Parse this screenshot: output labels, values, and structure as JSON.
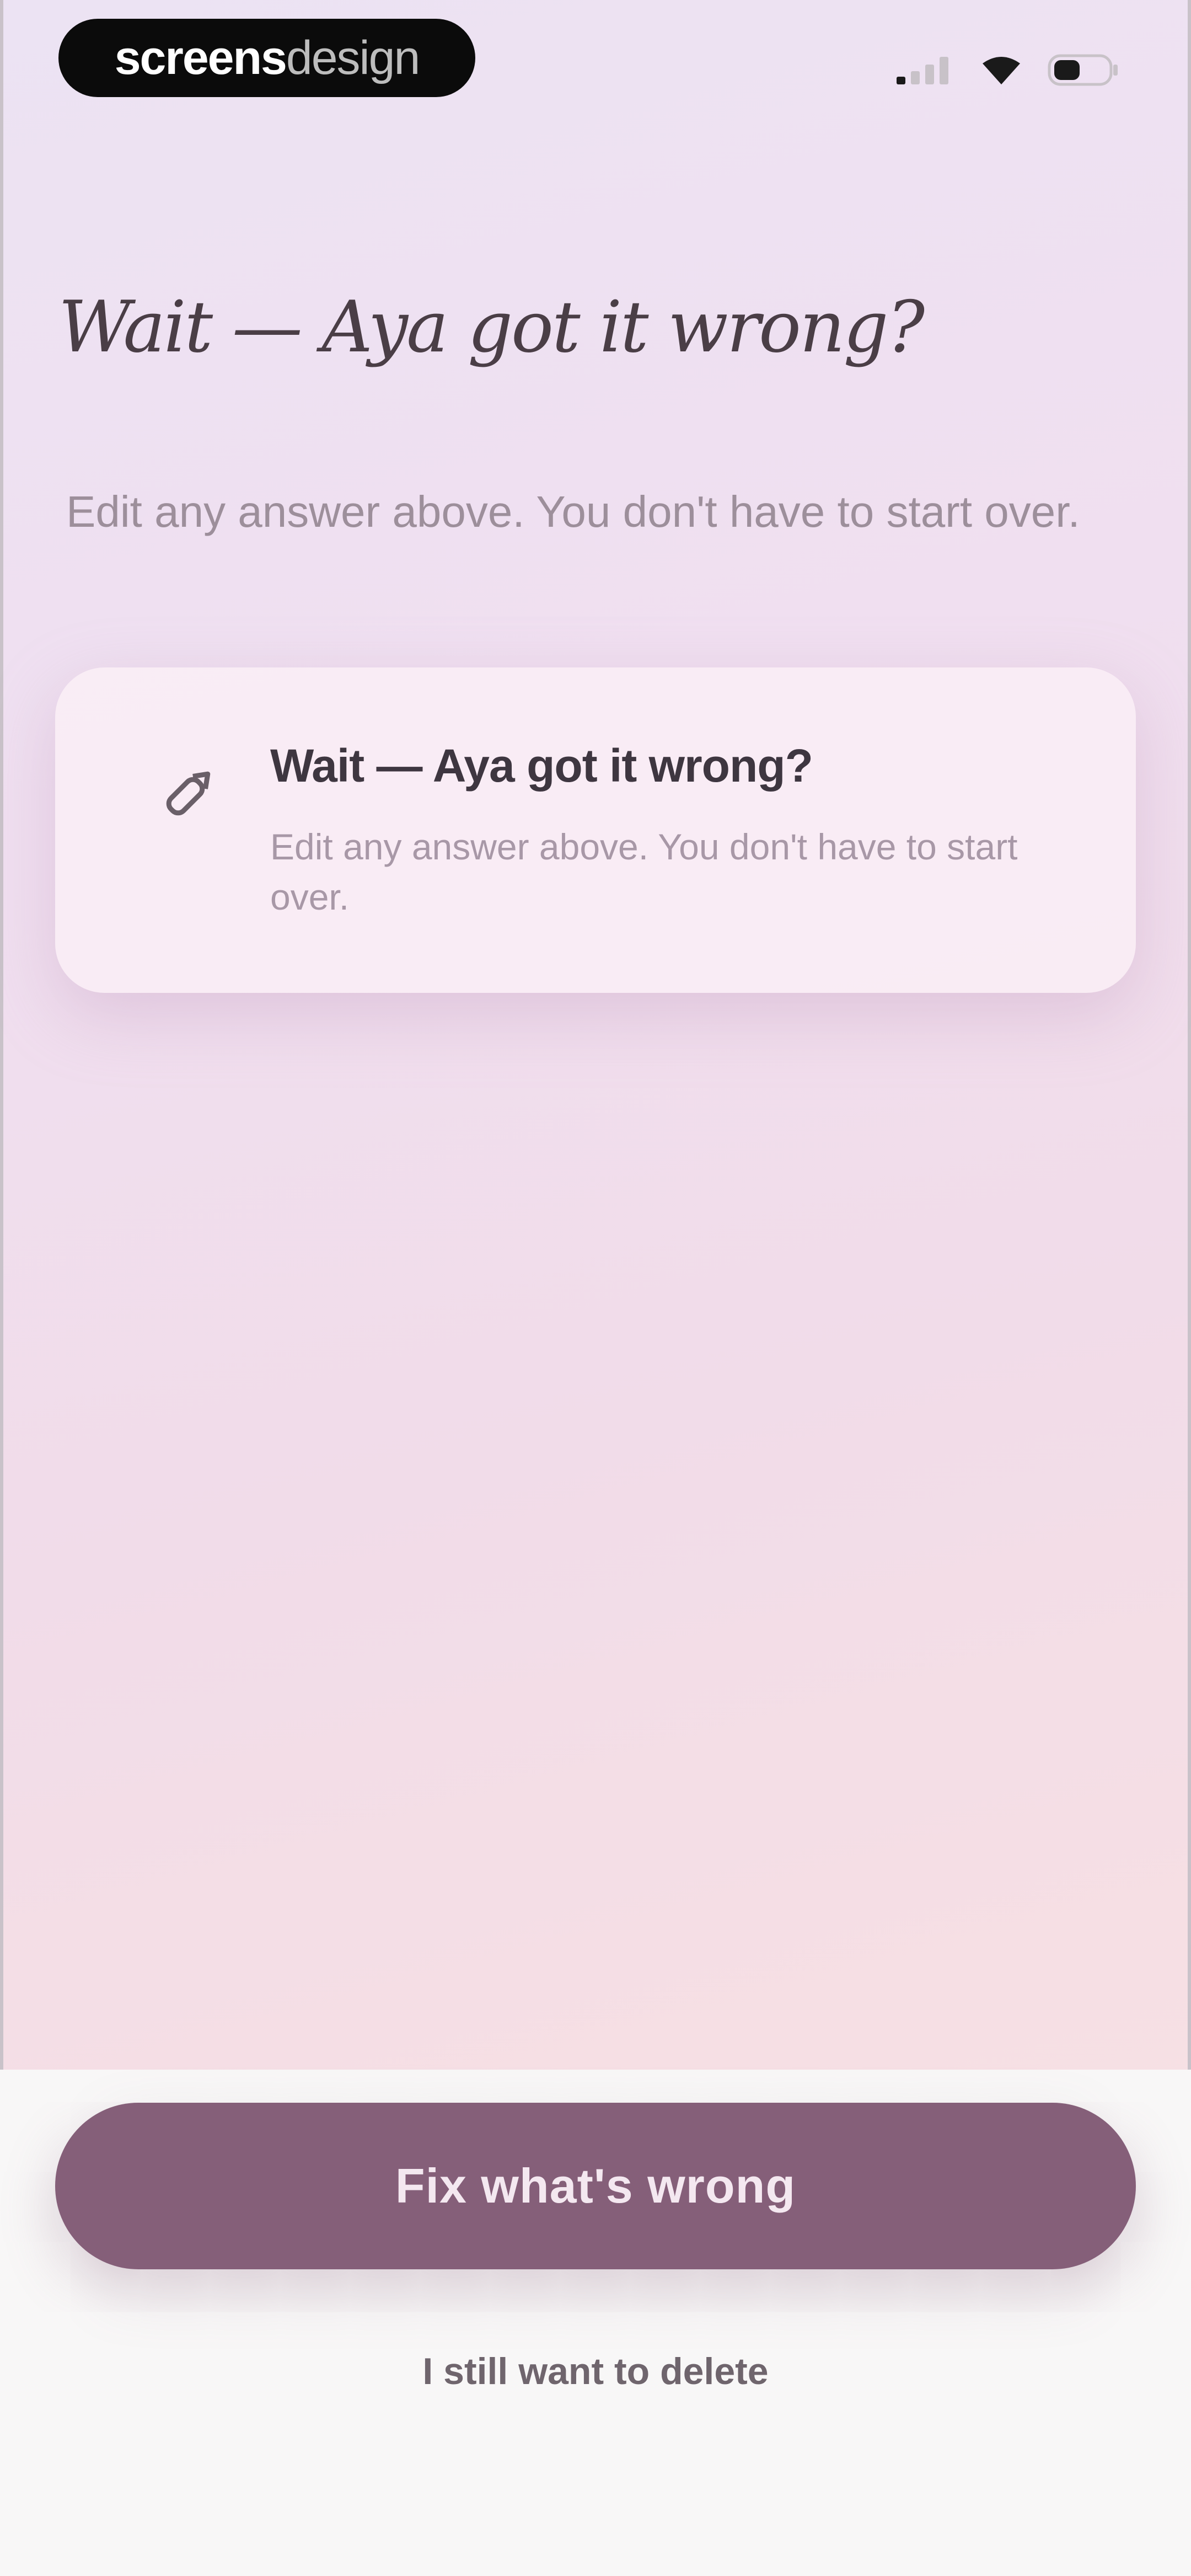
{
  "status_bar": {
    "brand_bold": "screens",
    "brand_light": "design",
    "icons": [
      "signal-icon",
      "wifi-icon",
      "battery-icon"
    ]
  },
  "header": {
    "title": "Wait — Aya got it wrong?",
    "subtitle": "Edit any answer above. You don't have to start over."
  },
  "card": {
    "icon": "pencil-icon",
    "title": "Wait — Aya got it wrong?",
    "body": "Edit any answer above. You don't have to start over."
  },
  "actions": {
    "primary_label": "Fix what's wrong",
    "secondary_label": "I still want to delete"
  },
  "colors": {
    "primary_button": "#855f79",
    "background_top": "#ece3f3",
    "background_bottom": "#f9e2e2"
  }
}
